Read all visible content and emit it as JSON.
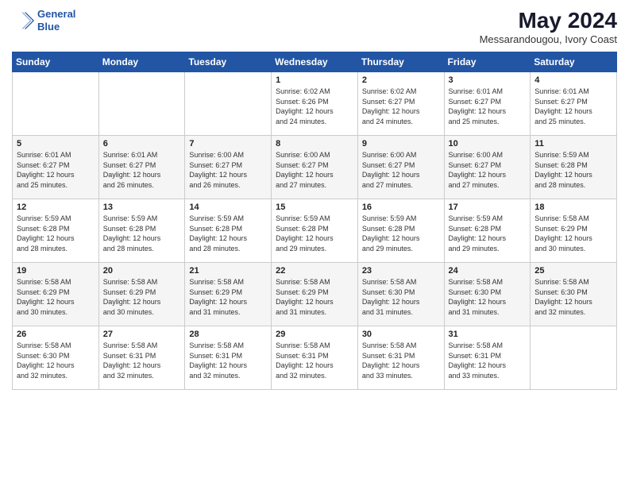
{
  "logo": {
    "line1": "General",
    "line2": "Blue"
  },
  "title": "May 2024",
  "location": "Messarandougou, Ivory Coast",
  "days_of_week": [
    "Sunday",
    "Monday",
    "Tuesday",
    "Wednesday",
    "Thursday",
    "Friday",
    "Saturday"
  ],
  "weeks": [
    [
      {
        "day": "",
        "info": ""
      },
      {
        "day": "",
        "info": ""
      },
      {
        "day": "",
        "info": ""
      },
      {
        "day": "1",
        "info": "Sunrise: 6:02 AM\nSunset: 6:26 PM\nDaylight: 12 hours\nand 24 minutes."
      },
      {
        "day": "2",
        "info": "Sunrise: 6:02 AM\nSunset: 6:27 PM\nDaylight: 12 hours\nand 24 minutes."
      },
      {
        "day": "3",
        "info": "Sunrise: 6:01 AM\nSunset: 6:27 PM\nDaylight: 12 hours\nand 25 minutes."
      },
      {
        "day": "4",
        "info": "Sunrise: 6:01 AM\nSunset: 6:27 PM\nDaylight: 12 hours\nand 25 minutes."
      }
    ],
    [
      {
        "day": "5",
        "info": "Sunrise: 6:01 AM\nSunset: 6:27 PM\nDaylight: 12 hours\nand 25 minutes."
      },
      {
        "day": "6",
        "info": "Sunrise: 6:01 AM\nSunset: 6:27 PM\nDaylight: 12 hours\nand 26 minutes."
      },
      {
        "day": "7",
        "info": "Sunrise: 6:00 AM\nSunset: 6:27 PM\nDaylight: 12 hours\nand 26 minutes."
      },
      {
        "day": "8",
        "info": "Sunrise: 6:00 AM\nSunset: 6:27 PM\nDaylight: 12 hours\nand 27 minutes."
      },
      {
        "day": "9",
        "info": "Sunrise: 6:00 AM\nSunset: 6:27 PM\nDaylight: 12 hours\nand 27 minutes."
      },
      {
        "day": "10",
        "info": "Sunrise: 6:00 AM\nSunset: 6:27 PM\nDaylight: 12 hours\nand 27 minutes."
      },
      {
        "day": "11",
        "info": "Sunrise: 5:59 AM\nSunset: 6:28 PM\nDaylight: 12 hours\nand 28 minutes."
      }
    ],
    [
      {
        "day": "12",
        "info": "Sunrise: 5:59 AM\nSunset: 6:28 PM\nDaylight: 12 hours\nand 28 minutes."
      },
      {
        "day": "13",
        "info": "Sunrise: 5:59 AM\nSunset: 6:28 PM\nDaylight: 12 hours\nand 28 minutes."
      },
      {
        "day": "14",
        "info": "Sunrise: 5:59 AM\nSunset: 6:28 PM\nDaylight: 12 hours\nand 28 minutes."
      },
      {
        "day": "15",
        "info": "Sunrise: 5:59 AM\nSunset: 6:28 PM\nDaylight: 12 hours\nand 29 minutes."
      },
      {
        "day": "16",
        "info": "Sunrise: 5:59 AM\nSunset: 6:28 PM\nDaylight: 12 hours\nand 29 minutes."
      },
      {
        "day": "17",
        "info": "Sunrise: 5:59 AM\nSunset: 6:28 PM\nDaylight: 12 hours\nand 29 minutes."
      },
      {
        "day": "18",
        "info": "Sunrise: 5:58 AM\nSunset: 6:29 PM\nDaylight: 12 hours\nand 30 minutes."
      }
    ],
    [
      {
        "day": "19",
        "info": "Sunrise: 5:58 AM\nSunset: 6:29 PM\nDaylight: 12 hours\nand 30 minutes."
      },
      {
        "day": "20",
        "info": "Sunrise: 5:58 AM\nSunset: 6:29 PM\nDaylight: 12 hours\nand 30 minutes."
      },
      {
        "day": "21",
        "info": "Sunrise: 5:58 AM\nSunset: 6:29 PM\nDaylight: 12 hours\nand 31 minutes."
      },
      {
        "day": "22",
        "info": "Sunrise: 5:58 AM\nSunset: 6:29 PM\nDaylight: 12 hours\nand 31 minutes."
      },
      {
        "day": "23",
        "info": "Sunrise: 5:58 AM\nSunset: 6:30 PM\nDaylight: 12 hours\nand 31 minutes."
      },
      {
        "day": "24",
        "info": "Sunrise: 5:58 AM\nSunset: 6:30 PM\nDaylight: 12 hours\nand 31 minutes."
      },
      {
        "day": "25",
        "info": "Sunrise: 5:58 AM\nSunset: 6:30 PM\nDaylight: 12 hours\nand 32 minutes."
      }
    ],
    [
      {
        "day": "26",
        "info": "Sunrise: 5:58 AM\nSunset: 6:30 PM\nDaylight: 12 hours\nand 32 minutes."
      },
      {
        "day": "27",
        "info": "Sunrise: 5:58 AM\nSunset: 6:31 PM\nDaylight: 12 hours\nand 32 minutes."
      },
      {
        "day": "28",
        "info": "Sunrise: 5:58 AM\nSunset: 6:31 PM\nDaylight: 12 hours\nand 32 minutes."
      },
      {
        "day": "29",
        "info": "Sunrise: 5:58 AM\nSunset: 6:31 PM\nDaylight: 12 hours\nand 32 minutes."
      },
      {
        "day": "30",
        "info": "Sunrise: 5:58 AM\nSunset: 6:31 PM\nDaylight: 12 hours\nand 33 minutes."
      },
      {
        "day": "31",
        "info": "Sunrise: 5:58 AM\nSunset: 6:31 PM\nDaylight: 12 hours\nand 33 minutes."
      },
      {
        "day": "",
        "info": ""
      }
    ]
  ]
}
